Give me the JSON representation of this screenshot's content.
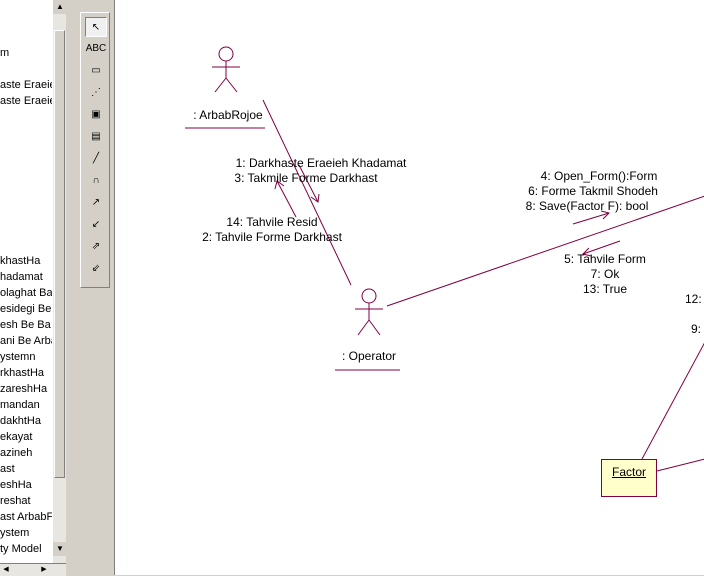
{
  "browser": {
    "items": [
      "m",
      "aste Eraeie",
      "aste Eraeie",
      "khastHa",
      "hadamat",
      "olaghat Ba",
      "esidegi Be",
      "esh Be Ba",
      "ani Be Arba",
      "ystemn",
      "rkhastHa",
      "zareshHa",
      "mandan",
      "dakhtHa",
      "ekayat",
      "azineh",
      "ast",
      "eshHa",
      "reshat",
      "ast ArbabF",
      "ystem",
      "ty Model"
    ]
  },
  "toolbox": {
    "tools": [
      {
        "name": "selection-arrow-icon",
        "glyph": "↖"
      },
      {
        "name": "text-tool-icon",
        "glyph": "ABC"
      },
      {
        "name": "note-icon",
        "glyph": "▭"
      },
      {
        "name": "anchor-note-icon",
        "glyph": "⋰"
      },
      {
        "name": "object-icon",
        "glyph": "▣"
      },
      {
        "name": "class-instance-icon",
        "glyph": "▤"
      },
      {
        "name": "object-link-icon",
        "glyph": "╱"
      },
      {
        "name": "link-to-self-icon",
        "glyph": "∩"
      },
      {
        "name": "link-message-icon",
        "glyph": "↗"
      },
      {
        "name": "reverse-link-message-icon",
        "glyph": "↙"
      },
      {
        "name": "data-flow-icon",
        "glyph": "⇗"
      },
      {
        "name": "reverse-data-flow-icon",
        "glyph": "⇙"
      }
    ]
  },
  "diagram": {
    "actors": {
      "arbab": ": ArbabRojoe",
      "operator": ": Operator"
    },
    "messages": {
      "m1": "1: Darkhaste Eraeieh Khadamat",
      "m3": "3: Takmile Forme Darkhast",
      "m14": "14: Tahvile Resid",
      "m2": "2: Tahvile Forme Darkhast",
      "m4": "4: Open_Form():Form",
      "m6": "6: Forme Takmil Shodeh",
      "m8": "8: Save(Factor F): bool",
      "m5": "5: Tahvile Form",
      "m7": "7: Ok",
      "m13": "13: True",
      "m12": "12:",
      "m9": "9:"
    },
    "factor": "Factor",
    "colors": {
      "line": "#800040",
      "factor_fill": "#ffffcc"
    }
  }
}
